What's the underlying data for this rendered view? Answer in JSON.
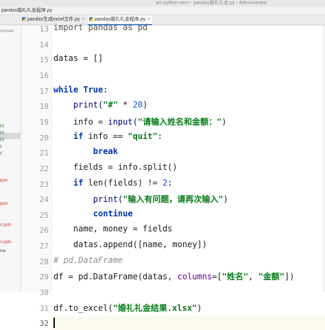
{
  "window": {
    "title": "am-python-zero - pandas婚礼礼金.py - Administrator"
  },
  "filebar": {
    "crumb": "pandas婚礼礼金程序.py"
  },
  "tabs": [
    {
      "label": "pandas生成excel文件.py",
      "active": false
    },
    {
      "label": "pandas婚礼礼金程序.py",
      "active": true
    }
  ],
  "sidebar": {
    "items": [
      "chmark",
      "py",
      "py",
      "py",
      "y",
      "y",
      "pptx",
      "pptx",
      "ma",
      "n.pptx",
      "n.pptx"
    ]
  },
  "editor": {
    "line_numbers": [
      "13",
      "14",
      "15",
      "16",
      "17",
      "18",
      "19",
      "20",
      "21",
      "22",
      "23",
      "24",
      "25",
      "26",
      "27",
      "28",
      "29",
      "30",
      "31",
      "32"
    ],
    "current_line": "32",
    "lines": {
      "l13": "import pandas as pd",
      "l15": "datas = []",
      "l17_kw": "while",
      "l17_true": "True",
      "l17_colon": ":",
      "l18_fn": "print(",
      "l18_str": "\"#\"",
      "l18_op": " * ",
      "l18_num": "20",
      "l18_end": ")",
      "l19_a": "info = ",
      "l19_fn": "input(",
      "l19_str": "\"请输入姓名和金额：\"",
      "l19_end": ")",
      "l20_kw": "if",
      "l20_a": " info == ",
      "l20_str": "\"quit\"",
      "l20_end": ":",
      "l21_kw": "break",
      "l22": "fields = info.split()",
      "l23_kw": "if",
      "l23_a": " len(fields) != ",
      "l23_num": "2",
      "l23_end": ":",
      "l24_fn": "print(",
      "l24_str": "\"输入有问题，请再次输入\"",
      "l24_end": ")",
      "l25_kw": "continue",
      "l26": "name, money = fields",
      "l27": "datas.append([name, money])",
      "l28": "# pd.DataFrame",
      "l29_a": "df = pd.DataFrame(datas, ",
      "l29_param": "columns",
      "l29_b": "=[",
      "l29_s1": "\"姓名\"",
      "l29_c": ", ",
      "l29_s2": "\"金额\"",
      "l29_end": "])",
      "l31_a": "df.to_excel(",
      "l31_str": "\"婚礼礼金结果.xlsx\"",
      "l31_end": ")"
    }
  }
}
